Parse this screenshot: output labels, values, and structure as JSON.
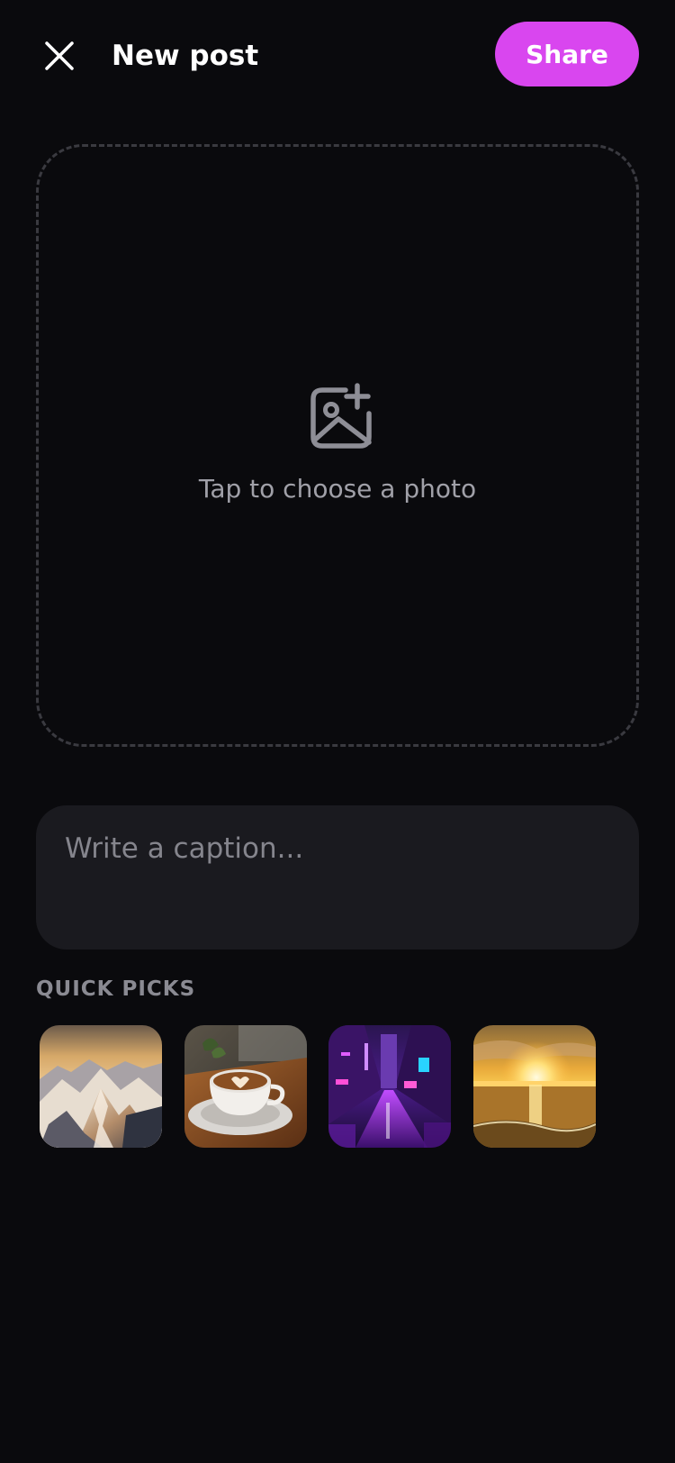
{
  "header": {
    "close_icon": "close-icon",
    "title": "New post",
    "share_label": "Share",
    "accent_color": "#d946ef"
  },
  "dropzone": {
    "icon": "add-image-icon",
    "text": "Tap to choose a photo"
  },
  "caption": {
    "placeholder": "Write a caption...",
    "value": ""
  },
  "quick_picks": {
    "label": "QUICK PICKS",
    "items": [
      {
        "subject": "snowy mountain range at sunset"
      },
      {
        "subject": "latte art coffee cup"
      },
      {
        "subject": "neon purple city street at night"
      },
      {
        "subject": "golden sunset over the sea"
      }
    ]
  }
}
